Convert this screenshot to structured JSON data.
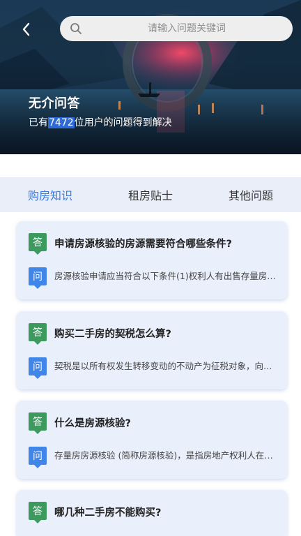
{
  "header": {
    "search_placeholder": "请输入问题关键词",
    "title": "无介问答",
    "subtitle_prefix": "已有",
    "user_count": "7472",
    "subtitle_suffix": "位用户的问题得到解决"
  },
  "tabs": [
    {
      "label": "购房知识",
      "active": true
    },
    {
      "label": "租房贴士",
      "active": false
    },
    {
      "label": "其他问题",
      "active": false
    }
  ],
  "badges": {
    "question": "答",
    "answer": "问"
  },
  "qa_list": [
    {
      "question": "申请房源核验的房源需要符合哪些条件?",
      "answer": "房源核验申请应当符合以下条件(1)权利人有出售存量房屋的意愿..."
    },
    {
      "question": "购买二手房的契税怎么算?",
      "answer": "契税是以所有权发生转移变动的不动产为征税对象，向产权承受人征收的..."
    },
    {
      "question": "什么是房源核验?",
      "answer": "存量房房源核验 (简称房源核验)，是指房地产权利人在出售房屋前..."
    },
    {
      "question": "哪几种二手房不能购买?",
      "answer": ""
    }
  ],
  "colors": {
    "accent": "#3a7be0",
    "tab_bar_bg": "#e9eef9",
    "card_bg": "#e9effb",
    "answer_badge": "#3c9a5e",
    "ask_badge": "#3f86e8",
    "count_highlight": "#2f6bd8"
  },
  "icons": {
    "back": "chevron-left-icon",
    "search": "search-icon"
  }
}
